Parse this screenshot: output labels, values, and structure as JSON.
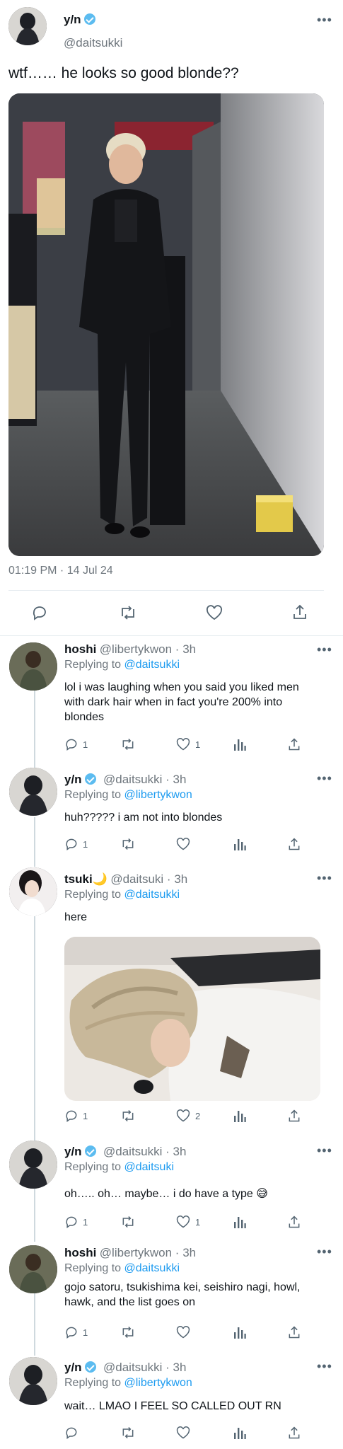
{
  "main_tweet": {
    "name": "y/n",
    "handle": "@daitsukki",
    "text": "wtf…… he looks so good blonde??",
    "timestamp": "01:19 PM · 14 Jul 24"
  },
  "replies": [
    {
      "name": "hoshi",
      "verified": false,
      "handle_time": "@libertykwon · 3h",
      "replying_prefix": "Replying to",
      "replying_to": "@daitsukki",
      "text": "lol i was laughing when you said you liked men with dark hair when in fact you're 200% into blondes",
      "reply_count": "1",
      "like_count": "1"
    },
    {
      "name": "y/n",
      "verified": true,
      "handle_time": "@daitsukki · 3h",
      "replying_prefix": "Replying to",
      "replying_to": "@libertykwon",
      "text": "huh????? i am not into blondes",
      "reply_count": "1",
      "like_count": ""
    },
    {
      "name": "tsuki🌙",
      "verified": false,
      "handle_time": "@daitsuki · 3h",
      "replying_prefix": "Replying to",
      "replying_to": "@daitsukki",
      "text": "here",
      "reply_count": "1",
      "like_count": "2"
    },
    {
      "name": "y/n",
      "verified": true,
      "handle_time": "@daitsukki · 3h",
      "replying_prefix": "Replying to",
      "replying_to": "@daitsuki",
      "text": "oh….. oh… maybe… i do have a type 😅",
      "reply_count": "1",
      "like_count": "1"
    },
    {
      "name": "hoshi",
      "verified": false,
      "handle_time": "@libertykwon · 3h",
      "replying_prefix": "Replying to",
      "replying_to": "@daitsukki",
      "text": "gojo satoru, tsukishima kei, seishiro nagi, howl, hawk, and the list goes on",
      "reply_count": "1",
      "like_count": ""
    },
    {
      "name": "y/n",
      "verified": true,
      "handle_time": "@daitsukki · 3h",
      "replying_prefix": "Replying to",
      "replying_to": "@libertykwon",
      "text": "wait… LMAO I FEEL SO CALLED OUT RN",
      "reply_count": "",
      "like_count": ""
    }
  ],
  "icons": {
    "reply": "reply-icon",
    "retweet": "retweet-icon",
    "like": "like-icon",
    "views": "views-icon",
    "share": "share-icon",
    "more": "more-icon"
  },
  "colors": {
    "link": "#1d9bf0",
    "verified": "#5cbcf0",
    "muted": "#6e767d"
  }
}
